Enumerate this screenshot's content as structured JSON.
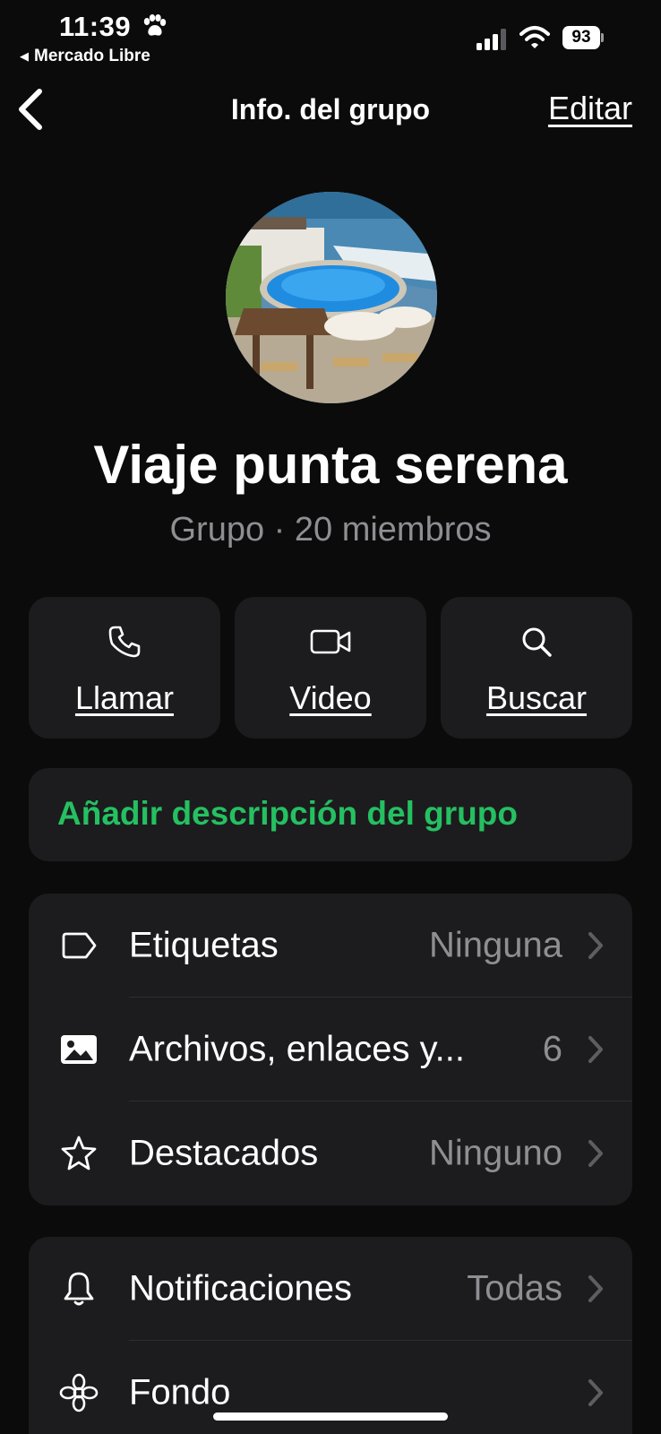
{
  "status_bar": {
    "time": "11:39",
    "back_app": "Mercado Libre",
    "battery": "93"
  },
  "nav": {
    "title": "Info. del grupo",
    "edit_label": "Editar"
  },
  "group": {
    "name": "Viaje punta serena",
    "meta": "Grupo · 20 miembros"
  },
  "actions": [
    {
      "label": "Llamar",
      "icon": "phone-icon"
    },
    {
      "label": "Video",
      "icon": "video-icon"
    },
    {
      "label": "Buscar",
      "icon": "search-icon"
    }
  ],
  "description": {
    "add_label": "Añadir descripción del grupo"
  },
  "section1": [
    {
      "label": "Etiquetas",
      "value": "Ninguna",
      "icon": "tag-icon"
    },
    {
      "label": "Archivos, enlaces y...",
      "value": "6",
      "icon": "image-icon"
    },
    {
      "label": "Destacados",
      "value": "Ninguno",
      "icon": "star-icon"
    }
  ],
  "section2": [
    {
      "label": "Notificaciones",
      "value": "Todas",
      "icon": "bell-icon"
    },
    {
      "label": "Fondo",
      "value": "",
      "icon": "flower-icon"
    }
  ],
  "colors": {
    "background": "#0b0b0b",
    "card": "#1c1c1e",
    "accent_green": "#25c061",
    "secondary_text": "#8e8e93"
  }
}
